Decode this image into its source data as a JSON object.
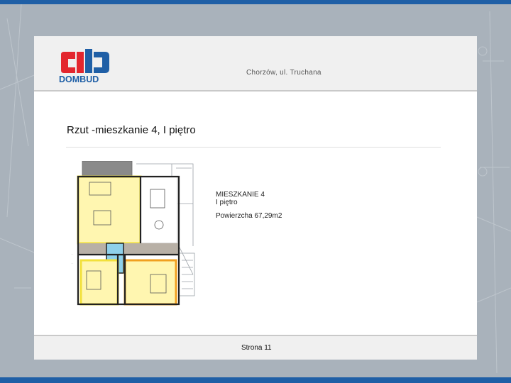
{
  "logo": {
    "brand": "DOMBUD",
    "brand_color": "#1f5fa6",
    "accent_color": "#e3262e"
  },
  "header": {
    "location": "Chorzów, ul. Truchana"
  },
  "slide": {
    "title": "Rzut -mieszkanie 4, I piętro"
  },
  "apartment": {
    "name": "MIESZKANIE 4",
    "floor": "I piętro",
    "area": "Powierzcha 67,29m2"
  },
  "footer": {
    "page": "Strona 11"
  },
  "colors": {
    "frame_bar": "#1f5fa6",
    "room_outline_yellow": "#f2e03a",
    "room_outline_orange": "#f0a020",
    "bathroom_blue": "#8fd0ea",
    "hall_gray": "#b8b0a6"
  }
}
